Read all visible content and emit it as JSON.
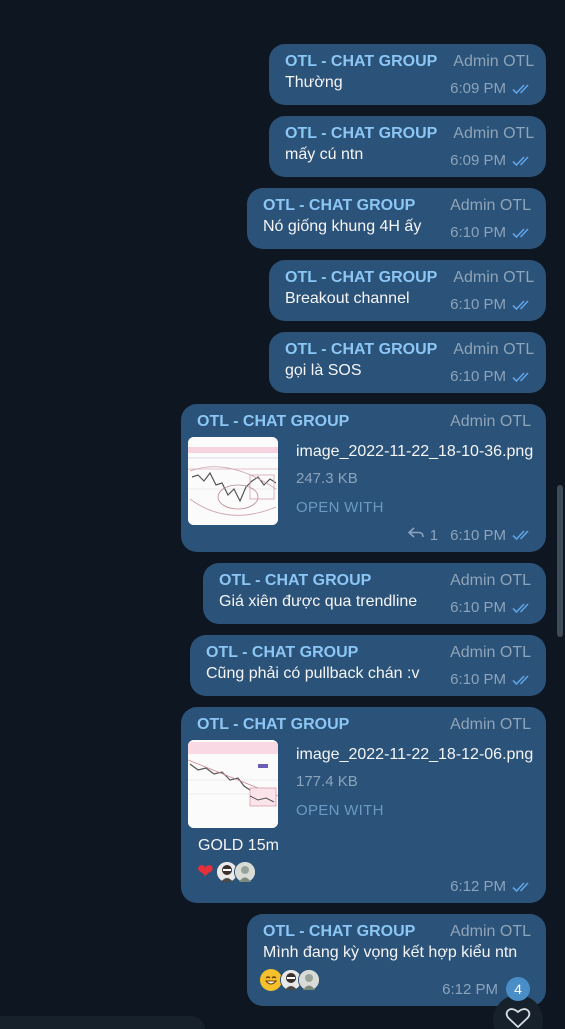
{
  "chat": {
    "messages": [
      {
        "sender": "OTL - CHAT GROUP",
        "author": "Admin OTL",
        "text": "Thường",
        "time": "6:09 PM"
      },
      {
        "sender": "OTL - CHAT GROUP",
        "author": "Admin OTL",
        "text": "mấy cú ntn",
        "time": "6:09 PM"
      },
      {
        "sender": "OTL - CHAT GROUP",
        "author": "Admin OTL",
        "text": "Nó giống khung 4H ấy",
        "time": "6:10 PM"
      },
      {
        "sender": "OTL - CHAT GROUP",
        "author": "Admin OTL",
        "text": "Breakout channel",
        "time": "6:10 PM"
      },
      {
        "sender": "OTL - CHAT GROUP",
        "author": "Admin OTL",
        "text": "gọi là SOS",
        "time": "6:10 PM"
      },
      {
        "sender": "OTL - CHAT GROUP",
        "author": "Admin OTL",
        "file_name": "image_2022-11-22_18-10-36.png",
        "file_size": "247.3 KB",
        "open_with": "OPEN WITH",
        "reply_count": "1",
        "time": "6:10 PM"
      },
      {
        "sender": "OTL - CHAT GROUP",
        "author": "Admin OTL",
        "text": "Giá xiên được qua trendline",
        "time": "6:10 PM"
      },
      {
        "sender": "OTL - CHAT GROUP",
        "author": "Admin OTL",
        "text": "Cũng phải có pullback chán :v",
        "time": "6:10 PM"
      },
      {
        "sender": "OTL - CHAT GROUP",
        "author": "Admin OTL",
        "file_name": "image_2022-11-22_18-12-06.png",
        "file_size": "177.4 KB",
        "open_with": "OPEN WITH",
        "caption": "GOLD 15m",
        "reactions": [
          "heart-icon",
          "user-avatar",
          "user-avatar"
        ],
        "time": "6:12 PM"
      },
      {
        "sender": "OTL - CHAT GROUP",
        "author": "Admin OTL",
        "text": "Mình đang kỳ vọng kết hợp kiểu ntn",
        "reactions": [
          "grin-emoji",
          "user-avatar",
          "user-avatar"
        ],
        "time": "6:12 PM"
      }
    ],
    "unread_count": "4"
  },
  "icons": {
    "read_status": "double-check-icon",
    "reply": "reply-arrow-icon",
    "scroll_button": "heart-outline-icon"
  },
  "colors": {
    "background": "#0e1621",
    "bubble": "#2b5278",
    "sender": "#8cc6f5",
    "meta": "#8ba4bd"
  }
}
